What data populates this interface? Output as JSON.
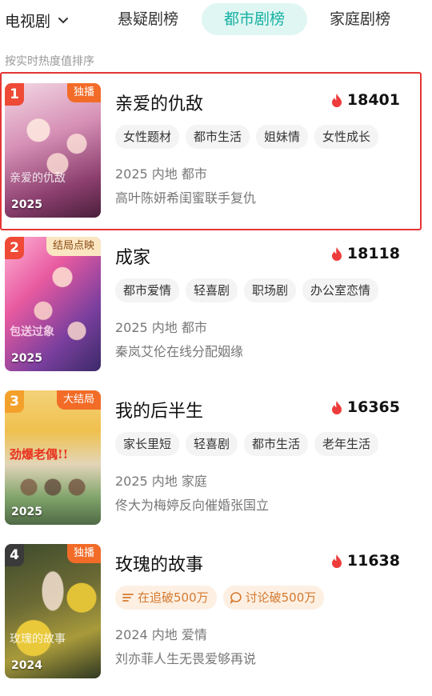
{
  "header": {
    "category": "电视剧",
    "tabs": [
      {
        "label": "悬疑剧榜",
        "active": false
      },
      {
        "label": "都市剧榜",
        "active": true
      },
      {
        "label": "家庭剧榜",
        "active": false
      }
    ],
    "hint": "按实时热度值排序"
  },
  "items": [
    {
      "rank": "1",
      "badge": "独播",
      "year": "2025",
      "poster_title": "亲爱的仇敌",
      "title": "亲爱的仇敌",
      "heat": "18401",
      "tags": [
        "女性题材",
        "都市生活",
        "姐妹情",
        "女性成长"
      ],
      "meta": "2025 内地 都市",
      "desc": "高叶陈妍希闺蜜联手复仇"
    },
    {
      "rank": "2",
      "badge": "结局点映",
      "year": "2025",
      "poster_title": "包送过象",
      "title": "成家",
      "heat": "18118",
      "tags": [
        "都市爱情",
        "轻喜剧",
        "职场剧",
        "办公室恋情"
      ],
      "meta": "2025 内地 都市",
      "desc": "秦岚艾伦在线分配姻缘"
    },
    {
      "rank": "3",
      "badge": "大结局",
      "year": "2025",
      "poster_title": "劲爆老偶!!",
      "title": "我的后半生",
      "heat": "16365",
      "tags": [
        "家长里短",
        "轻喜剧",
        "都市生活",
        "老年生活"
      ],
      "meta": "2025 内地 家庭",
      "desc": "佟大为梅婷反向催婚张国立"
    },
    {
      "rank": "4",
      "badge": "独播",
      "year": "2024",
      "poster_title": "玫瑰的故事",
      "title": "玫瑰的故事",
      "heat": "11638",
      "hot_tags": [
        "在追破500万",
        "讨论破500万"
      ],
      "meta": "2024 内地 爱情",
      "desc": "刘亦菲人生无畏爱够再说"
    }
  ],
  "colors": {
    "accent": "#17b1a2",
    "selection": "#e53535",
    "flame": "#ee3b3b",
    "badge": "#f26c28"
  },
  "icons": {
    "dropdown": "chevron-down-icon",
    "heat": "flame-icon",
    "following": "list-icon",
    "discussion": "chat-bubble-icon"
  }
}
